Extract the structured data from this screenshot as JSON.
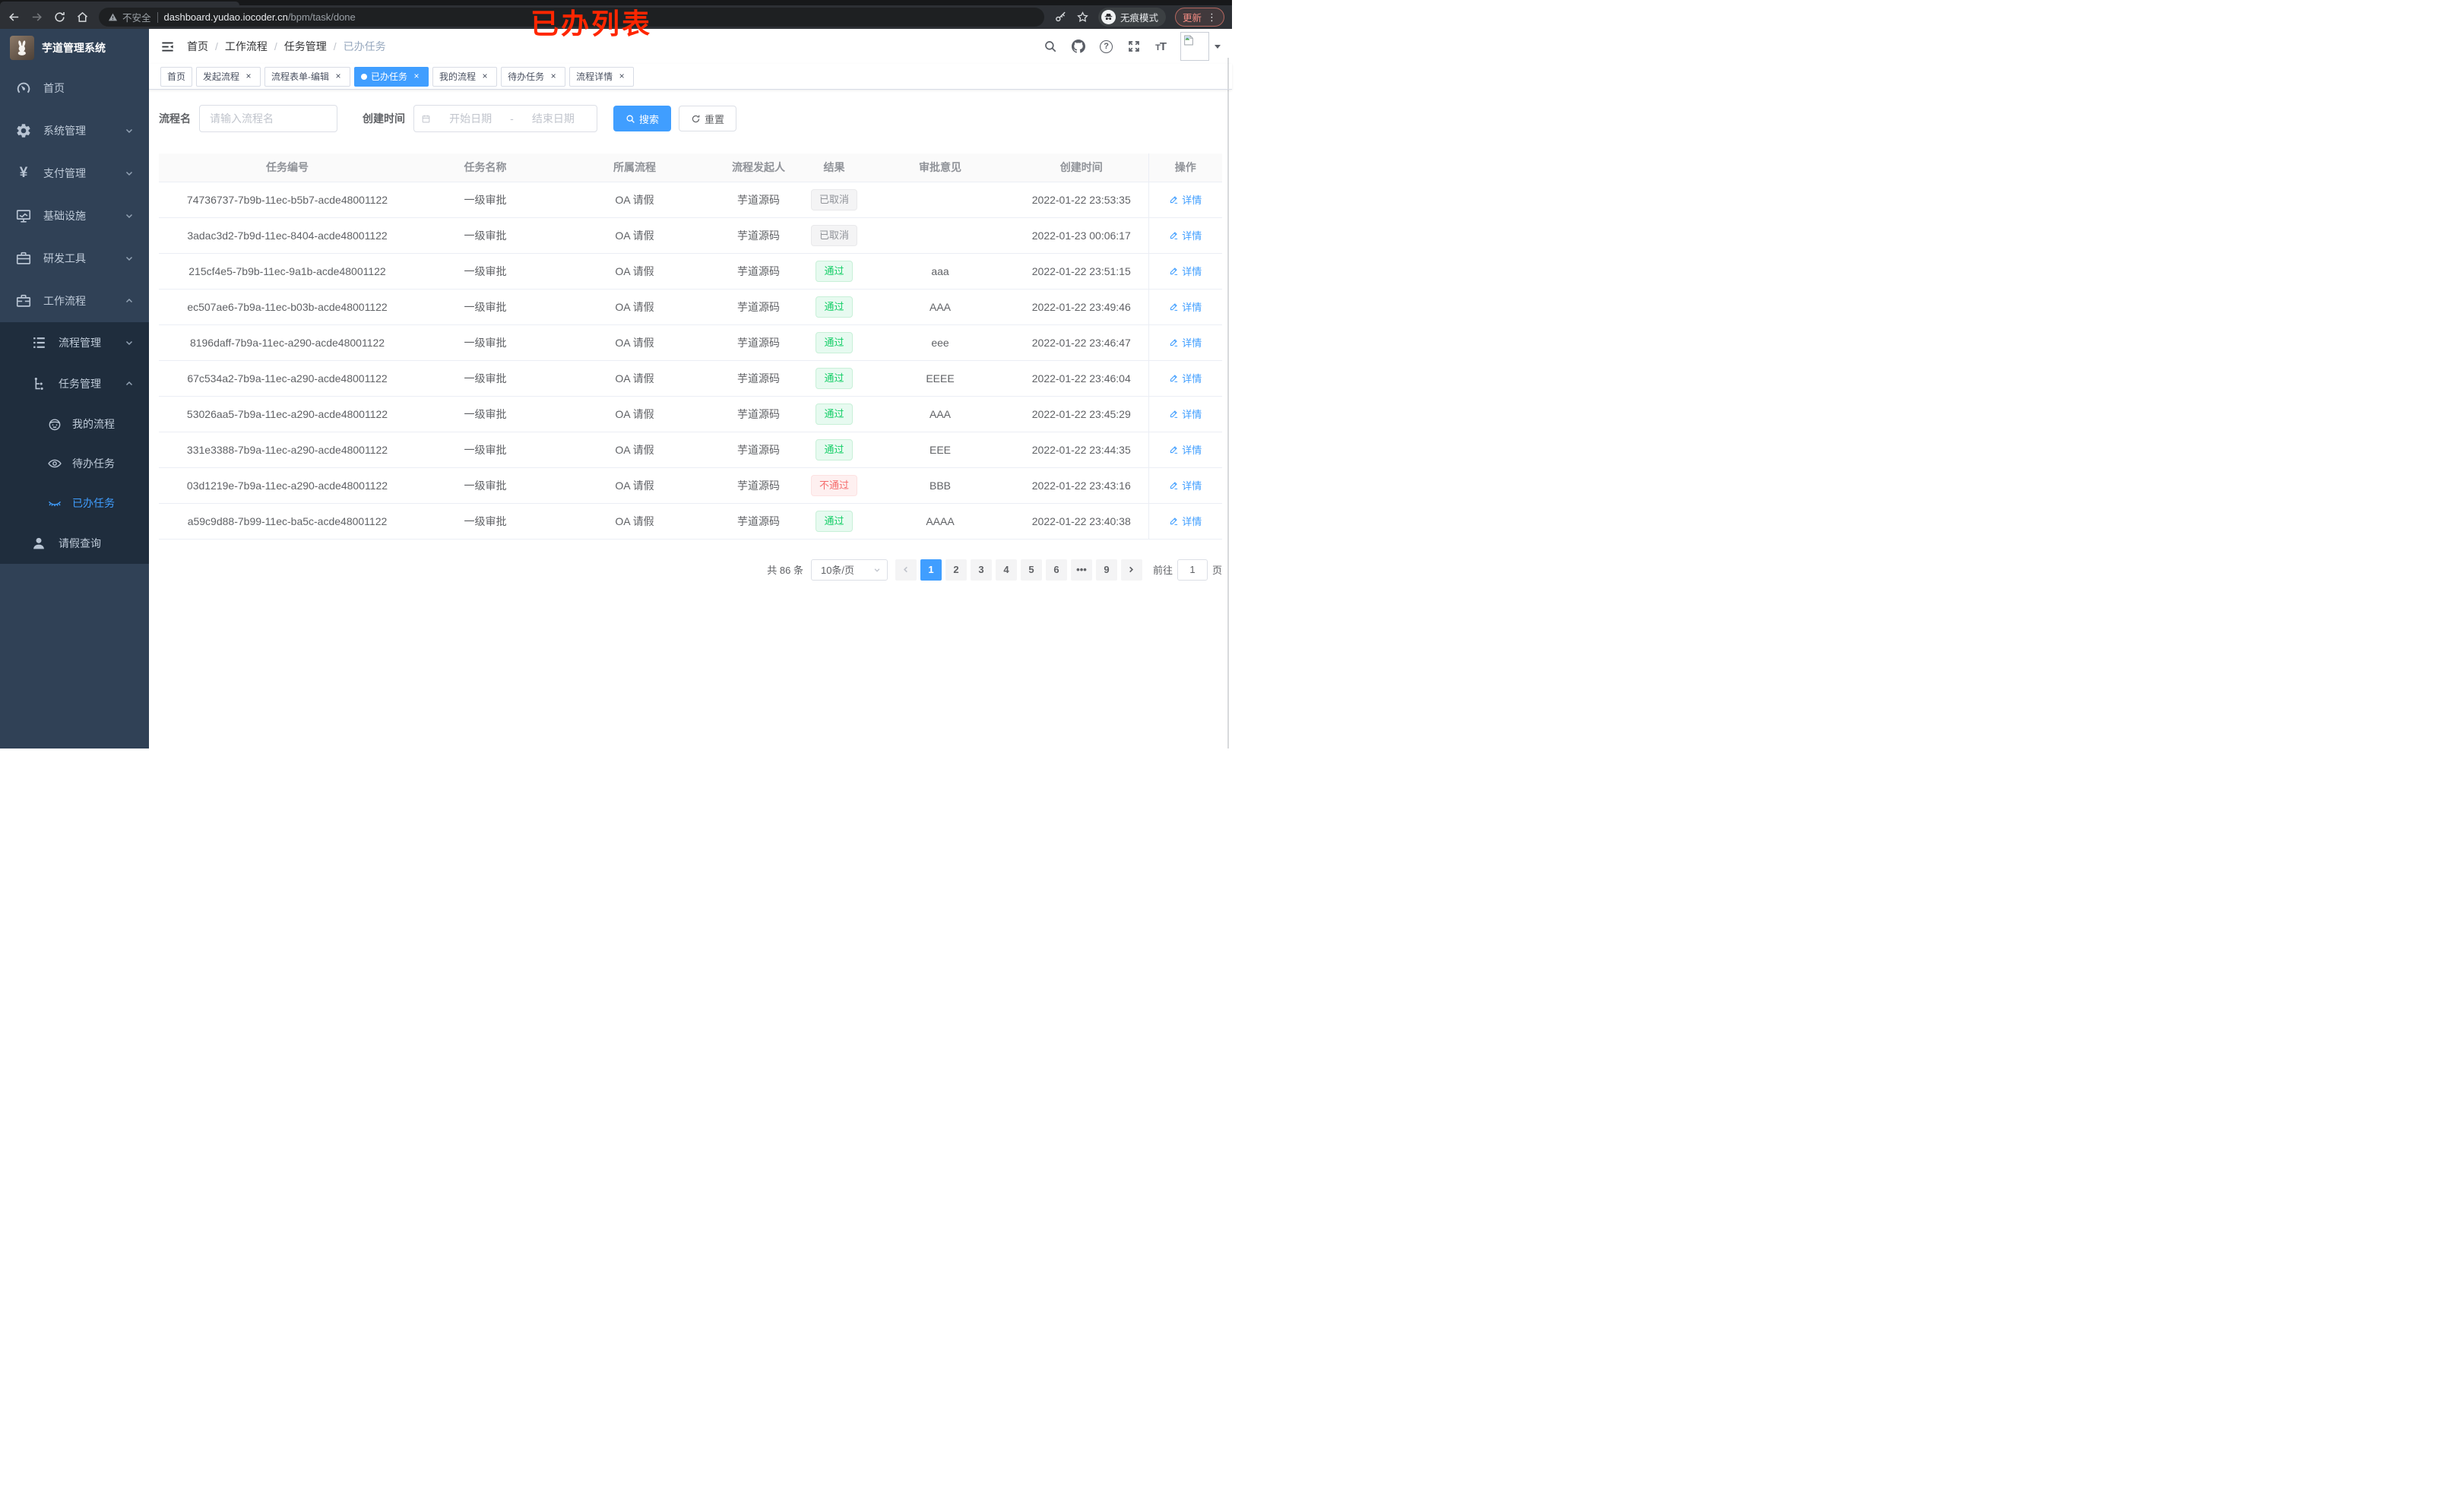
{
  "browser": {
    "security_label": "不安全",
    "url_host": "dashboard.yudao.iocoder.cn",
    "url_path": "/bpm/task/done",
    "incognito_label": "无痕模式",
    "update_label": "更新"
  },
  "annotation": {
    "text": "已办列表",
    "color": "#ff2600"
  },
  "sidebar": {
    "title": "芋道管理系统",
    "items": [
      {
        "label": "首页",
        "icon": "dashboard-icon"
      },
      {
        "label": "系统管理",
        "icon": "gear-icon",
        "chevron": "down"
      },
      {
        "label": "支付管理",
        "icon": "yen-icon",
        "chevron": "down"
      },
      {
        "label": "基础设施",
        "icon": "monitor-icon",
        "chevron": "down"
      },
      {
        "label": "研发工具",
        "icon": "toolbox-icon",
        "chevron": "down"
      },
      {
        "label": "工作流程",
        "icon": "workflow-icon",
        "chevron": "up"
      }
    ],
    "submenu": {
      "process_mgmt": {
        "label": "流程管理",
        "chevron": "down"
      },
      "task_mgmt": {
        "label": "任务管理",
        "chevron": "up"
      },
      "children": [
        {
          "label": "我的流程",
          "active": false
        },
        {
          "label": "待办任务",
          "active": false
        },
        {
          "label": "已办任务",
          "active": true
        }
      ],
      "leave_query": {
        "label": "请假查询"
      }
    }
  },
  "breadcrumb": [
    "首页",
    "工作流程",
    "任务管理",
    "已办任务"
  ],
  "tabs": [
    {
      "label": "首页",
      "closable": false,
      "active": false
    },
    {
      "label": "发起流程",
      "closable": true,
      "active": false
    },
    {
      "label": "流程表单-编辑",
      "closable": true,
      "active": false
    },
    {
      "label": "已办任务",
      "closable": true,
      "active": true
    },
    {
      "label": "我的流程",
      "closable": true,
      "active": false
    },
    {
      "label": "待办任务",
      "closable": true,
      "active": false
    },
    {
      "label": "流程详情",
      "closable": true,
      "active": false
    }
  ],
  "filters": {
    "name_label": "流程名",
    "name_placeholder": "请输入流程名",
    "time_label": "创建时间",
    "start_placeholder": "开始日期",
    "range_separator": "-",
    "end_placeholder": "结束日期",
    "search_label": "搜索",
    "reset_label": "重置"
  },
  "table": {
    "columns": [
      "任务编号",
      "任务名称",
      "所属流程",
      "流程发起人",
      "结果",
      "审批意见",
      "创建时间",
      "操作"
    ],
    "rows": [
      {
        "id": "74736737-7b9b-11ec-b5b7-acde48001122",
        "name": "一级审批",
        "process": "OA 请假",
        "initiator": "芋道源码",
        "result": "已取消",
        "result_type": "info",
        "opinion": "",
        "create_time": "2022-01-22 23:53:35",
        "action": "详情"
      },
      {
        "id": "3adac3d2-7b9d-11ec-8404-acde48001122",
        "name": "一级审批",
        "process": "OA 请假",
        "initiator": "芋道源码",
        "result": "已取消",
        "result_type": "info",
        "opinion": "",
        "create_time": "2022-01-23 00:06:17",
        "action": "详情"
      },
      {
        "id": "215cf4e5-7b9b-11ec-9a1b-acde48001122",
        "name": "一级审批",
        "process": "OA 请假",
        "initiator": "芋道源码",
        "result": "通过",
        "result_type": "success",
        "opinion": "aaa",
        "create_time": "2022-01-22 23:51:15",
        "action": "详情"
      },
      {
        "id": "ec507ae6-7b9a-11ec-b03b-acde48001122",
        "name": "一级审批",
        "process": "OA 请假",
        "initiator": "芋道源码",
        "result": "通过",
        "result_type": "success",
        "opinion": "AAA",
        "create_time": "2022-01-22 23:49:46",
        "action": "详情"
      },
      {
        "id": "8196daff-7b9a-11ec-a290-acde48001122",
        "name": "一级审批",
        "process": "OA 请假",
        "initiator": "芋道源码",
        "result": "通过",
        "result_type": "success",
        "opinion": "eee",
        "create_time": "2022-01-22 23:46:47",
        "action": "详情"
      },
      {
        "id": "67c534a2-7b9a-11ec-a290-acde48001122",
        "name": "一级审批",
        "process": "OA 请假",
        "initiator": "芋道源码",
        "result": "通过",
        "result_type": "success",
        "opinion": "EEEE",
        "create_time": "2022-01-22 23:46:04",
        "action": "详情"
      },
      {
        "id": "53026aa5-7b9a-11ec-a290-acde48001122",
        "name": "一级审批",
        "process": "OA 请假",
        "initiator": "芋道源码",
        "result": "通过",
        "result_type": "success",
        "opinion": "AAA",
        "create_time": "2022-01-22 23:45:29",
        "action": "详情"
      },
      {
        "id": "331e3388-7b9a-11ec-a290-acde48001122",
        "name": "一级审批",
        "process": "OA 请假",
        "initiator": "芋道源码",
        "result": "通过",
        "result_type": "success",
        "opinion": "EEE",
        "create_time": "2022-01-22 23:44:35",
        "action": "详情"
      },
      {
        "id": "03d1219e-7b9a-11ec-a290-acde48001122",
        "name": "一级审批",
        "process": "OA 请假",
        "initiator": "芋道源码",
        "result": "不通过",
        "result_type": "danger",
        "opinion": "BBB",
        "create_time": "2022-01-22 23:43:16",
        "action": "详情"
      },
      {
        "id": "a59c9d88-7b99-11ec-ba5c-acde48001122",
        "name": "一级审批",
        "process": "OA 请假",
        "initiator": "芋道源码",
        "result": "通过",
        "result_type": "success",
        "opinion": "AAAA",
        "create_time": "2022-01-22 23:40:38",
        "action": "详情"
      }
    ]
  },
  "pagination": {
    "total_text": "共 86 条",
    "page_size": "10条/页",
    "pages": [
      {
        "label": "1",
        "active": true
      },
      {
        "label": "2"
      },
      {
        "label": "3"
      },
      {
        "label": "4"
      },
      {
        "label": "5"
      },
      {
        "label": "6"
      },
      {
        "label": "•••",
        "ellipsis": true
      },
      {
        "label": "9"
      }
    ],
    "goto_label": "前往",
    "goto_value": "1",
    "page_suffix": "页"
  },
  "colors": {
    "accent": "#409eff",
    "success": "#13ce66",
    "danger": "#f56c6c",
    "info": "#909399",
    "sidebar_bg": "#304156",
    "submenu_bg": "#1f2d3d"
  }
}
